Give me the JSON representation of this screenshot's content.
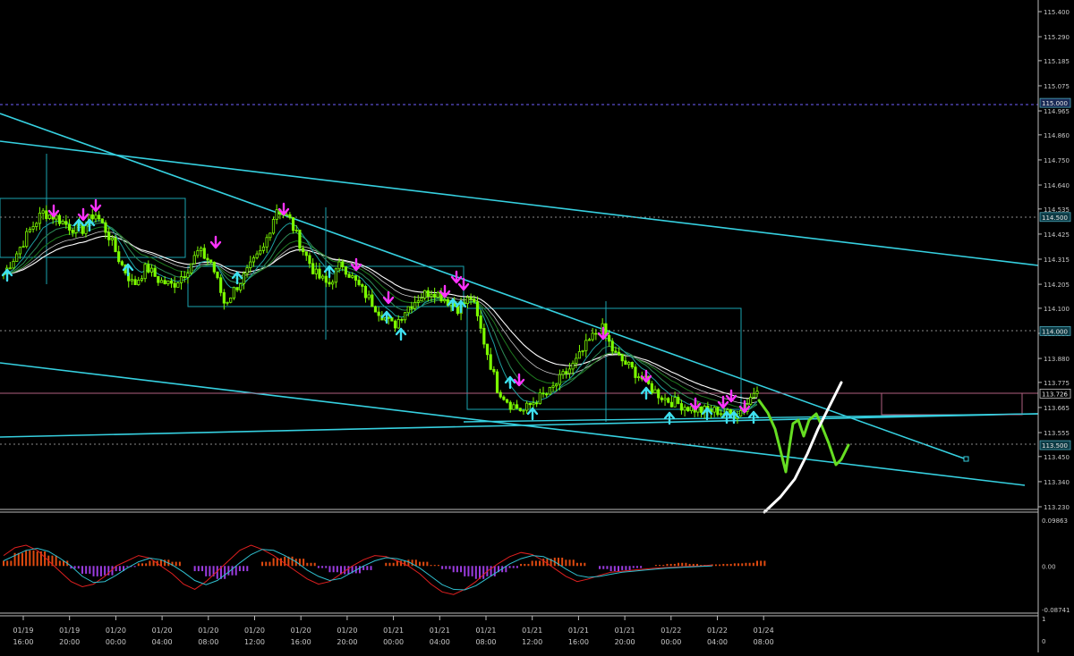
{
  "colors": {
    "background": "#000000",
    "axis": "#bbbbbb",
    "candle": "#7CFC00",
    "ma_white": "#ffffff",
    "ma_light": "#c9c9c9",
    "ma_green_dark": "#1f7a1f",
    "ma_green": "#2e8b57",
    "ma_cyan": "#1ea0a0",
    "trendline": "#36d0e0",
    "box": "#1aa3b0",
    "level_dotted": "#8a8a8a",
    "level_blue": "#6f5fff",
    "level_pink": "#b06080",
    "arrow_up": "#3fe0f0",
    "arrow_down": "#ff33ff",
    "forecast_green": "#66dd22",
    "forecast_white": "#ffffff",
    "hist_pos": "#e04a10",
    "hist_neg": "#9b3ce0",
    "osc_red": "#e02020",
    "osc_cyan": "#30c0d0"
  },
  "chart_data": [
    {
      "type": "line",
      "title": "",
      "ylim": [
        113.23,
        115.4
      ],
      "y_ticks": [
        "115.400",
        "115.290",
        "115.185",
        "115.075",
        "114.965",
        "114.860",
        "114.750",
        "114.640",
        "114.535",
        "114.425",
        "114.315",
        "114.205",
        "114.100",
        "113.990",
        "113.880",
        "113.775",
        "113.665",
        "113.555",
        "113.450",
        "113.340",
        "113.230"
      ],
      "level_labels": [
        "115.000",
        "114.500",
        "114.000",
        "113.726",
        "113.500"
      ],
      "level_values": [
        115.0,
        114.5,
        114.0,
        113.726,
        113.5
      ],
      "x_ticks": [
        {
          "date": "01/19",
          "time": "16:00"
        },
        {
          "date": "01/19",
          "time": "20:00"
        },
        {
          "date": "01/20",
          "time": "00:00"
        },
        {
          "date": "01/20",
          "time": "04:00"
        },
        {
          "date": "01/20",
          "time": "08:00"
        },
        {
          "date": "01/20",
          "time": "12:00"
        },
        {
          "date": "01/20",
          "time": "16:00"
        },
        {
          "date": "01/20",
          "time": "20:00"
        },
        {
          "date": "01/21",
          "time": "00:00"
        },
        {
          "date": "01/21",
          "time": "04:00"
        },
        {
          "date": "01/21",
          "time": "08:00"
        },
        {
          "date": "01/21",
          "time": "12:00"
        },
        {
          "date": "01/21",
          "time": "16:00"
        },
        {
          "date": "01/21",
          "time": "20:00"
        },
        {
          "date": "01/22",
          "time": "00:00"
        },
        {
          "date": "01/22",
          "time": "04:00"
        },
        {
          "date": "01/24",
          "time": "08:00"
        }
      ],
      "price_path": [
        114.25,
        114.34,
        114.44,
        114.52,
        114.5,
        114.46,
        114.44,
        114.52,
        114.43,
        114.3,
        114.2,
        114.28,
        114.22,
        114.2,
        114.26,
        114.35,
        114.3,
        114.12,
        114.2,
        114.28,
        114.36,
        114.54,
        114.49,
        114.36,
        114.25,
        114.2,
        114.3,
        114.22,
        114.15,
        114.08,
        114.02,
        114.1,
        114.15,
        114.18,
        114.14,
        114.1,
        114.15,
        113.95,
        113.75,
        113.68,
        113.65,
        113.7,
        113.73,
        113.8,
        113.86,
        113.95,
        114.02,
        113.9,
        113.85,
        113.8,
        113.74,
        113.7,
        113.68,
        113.66,
        113.65,
        113.65,
        113.63,
        113.66,
        113.76
      ]
    },
    {
      "type": "bar",
      "title": "",
      "ylim": [
        -0.08741,
        0.09863
      ],
      "y_ticks": [
        "0.09863",
        "0.00",
        "-0.08741"
      ],
      "series": [
        {
          "values": [
            0.01,
            0.025,
            0.03,
            0.028,
            0.02,
            0.01,
            -0.005,
            -0.015,
            -0.02,
            -0.018,
            -0.01,
            -0.002,
            0.005,
            0.01,
            0.012,
            0.008,
            0.0,
            -0.01,
            -0.02,
            -0.025,
            -0.018,
            -0.01,
            0.0,
            0.008,
            0.015,
            0.018,
            0.014,
            0.006,
            -0.004,
            -0.012,
            -0.016,
            -0.014,
            -0.008,
            0.0,
            0.006,
            0.01,
            0.012,
            0.008,
            0.002,
            -0.006,
            -0.012,
            -0.02,
            -0.025,
            -0.02,
            -0.012,
            -0.004,
            0.004,
            0.01,
            0.014,
            0.016,
            0.012,
            0.006,
            0.0,
            -0.006,
            -0.01,
            -0.008,
            -0.004,
            0.0,
            0.002,
            0.004,
            0.006,
            0.004,
            0.002,
            0.003,
            0.004,
            0.005,
            0.006,
            0.01
          ]
        },
        {
          "values": [
            0.02,
            0.035,
            0.04,
            0.03,
            0.01,
            -0.01,
            -0.03,
            -0.04,
            -0.035,
            -0.02,
            0.0,
            0.01,
            0.02,
            0.015,
            0.0,
            -0.015,
            -0.035,
            -0.045,
            -0.03,
            -0.01,
            0.01,
            0.03,
            0.04,
            0.032,
            0.02,
            0.005,
            -0.01,
            -0.025,
            -0.035,
            -0.03,
            -0.015,
            0.0,
            0.012,
            0.02,
            0.018,
            0.01,
            0.0,
            -0.015,
            -0.035,
            -0.05,
            -0.055,
            -0.045,
            -0.03,
            -0.01,
            0.005,
            0.018,
            0.026,
            0.022,
            0.01,
            -0.005,
            -0.02,
            -0.03,
            -0.025,
            -0.018,
            -0.012,
            -0.01,
            -0.008,
            -0.006,
            -0.004,
            -0.003,
            -0.002,
            -0.001,
            0.0,
            0.002
          ]
        },
        {
          "values": [
            0.01,
            0.02,
            0.03,
            0.034,
            0.028,
            0.015,
            0.0,
            -0.02,
            -0.032,
            -0.03,
            -0.018,
            -0.004,
            0.008,
            0.015,
            0.012,
            0.002,
            -0.012,
            -0.028,
            -0.036,
            -0.028,
            -0.012,
            0.006,
            0.022,
            0.032,
            0.03,
            0.02,
            0.008,
            -0.008,
            -0.02,
            -0.028,
            -0.024,
            -0.012,
            0.0,
            0.01,
            0.016,
            0.014,
            0.008,
            -0.004,
            -0.02,
            -0.036,
            -0.045,
            -0.046,
            -0.038,
            -0.024,
            -0.01,
            0.004,
            0.014,
            0.02,
            0.018,
            0.008,
            -0.006,
            -0.018,
            -0.022,
            -0.02,
            -0.016,
            -0.012,
            -0.01,
            -0.008,
            -0.006,
            -0.004,
            -0.003,
            -0.002,
            -0.001,
            0.0
          ]
        }
      ]
    },
    {
      "type": "bar",
      "title": "",
      "y_ticks": [
        "1",
        "0"
      ]
    }
  ]
}
